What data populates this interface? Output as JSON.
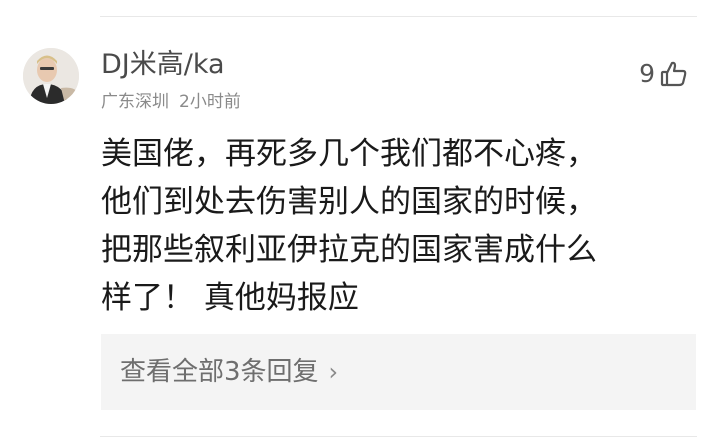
{
  "comment": {
    "username": "DJ米高/ka",
    "location": "广东深圳",
    "time": "2小时前",
    "like_count": "9",
    "body": "美国佬，再死多几个我们都不心疼，\n他们到处去伤害别人的国家的时候，\n把那些叙利亚伊拉克的国家害成什么\n样了！ 真他妈报应",
    "replies_label": "查看全部3条回复",
    "chevron": "›"
  },
  "icons": {
    "avatar": "user-avatar",
    "like": "thumbs-up-icon",
    "chevron": "chevron-right-icon"
  },
  "colors": {
    "username": "#4a4a4a",
    "meta": "#8a8a8a",
    "body": "#1a1a1a",
    "replies_bg": "#f4f4f4",
    "replies_text": "#6e6e6e"
  }
}
